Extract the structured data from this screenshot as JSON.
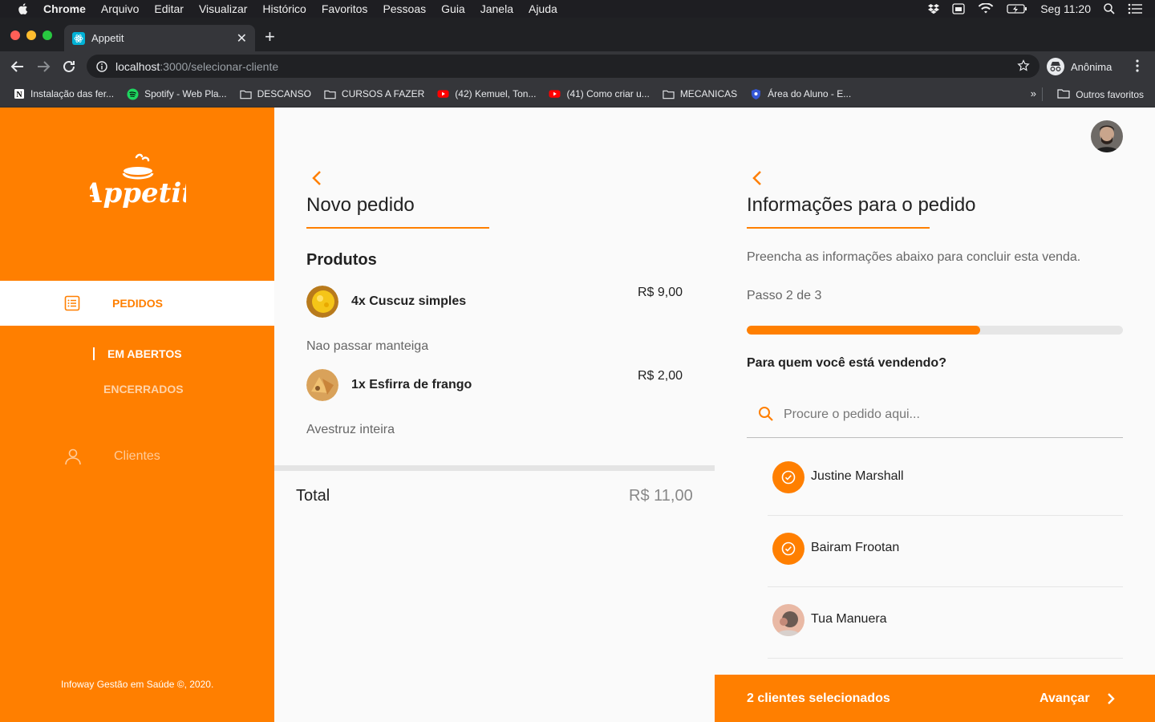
{
  "menubar": {
    "app": "Chrome",
    "items": [
      "Arquivo",
      "Editar",
      "Visualizar",
      "Histórico",
      "Favoritos",
      "Pessoas",
      "Guia",
      "Janela",
      "Ajuda"
    ],
    "clock": "Seg 11:20"
  },
  "browser": {
    "tab_title": "Appetit",
    "url_host": "localhost",
    "url_path": ":3000/selecionar-cliente",
    "profile_label": "Anônima",
    "bookmarks": [
      {
        "label": "Instalação das fer...",
        "icon": "notion-icon"
      },
      {
        "label": "Spotify - Web Pla...",
        "icon": "spotify-icon"
      },
      {
        "label": "DESCANSO",
        "icon": "folder-icon"
      },
      {
        "label": "CURSOS A FAZER",
        "icon": "folder-icon"
      },
      {
        "label": "(42) Kemuel, Ton...",
        "icon": "youtube-icon"
      },
      {
        "label": "(41) Como criar u...",
        "icon": "youtube-icon"
      },
      {
        "label": "MECANICAS",
        "icon": "folder-icon"
      },
      {
        "label": "Área do Aluno - E...",
        "icon": "shield-icon"
      }
    ],
    "bookmarks_more": "»",
    "other_bookmarks": "Outros favoritos"
  },
  "sidebar": {
    "logo_text": "Appetit",
    "nav_active": "PEDIDOS",
    "sub_active": "EM ABERTOS",
    "sub_inactive": "ENCERRADOS",
    "nav_clients": "Clientes",
    "copyright": "Infoway Gestão em Saúde ©, 2020."
  },
  "order": {
    "title": "Novo pedido",
    "products_heading": "Produtos",
    "products": [
      {
        "name": "4x Cuscuz simples",
        "price": "R$ 9,00",
        "note": "Nao passar manteiga"
      },
      {
        "name": "1x Esfirra de frango",
        "price": "R$ 2,00",
        "note": "Avestruz inteira"
      }
    ],
    "total_label": "Total",
    "total_value": "R$ 11,00"
  },
  "info": {
    "title": "Informações para o pedido",
    "description": "Preencha as informações abaixo para concluir esta venda.",
    "step": "Passo 2 de 3",
    "progress": 0.62,
    "question": "Para quem você está vendendo?",
    "search_placeholder": "Procure o pedido aqui...",
    "clients": [
      {
        "name": "Justine Marshall",
        "selected": true
      },
      {
        "name": "Bairam Frootan",
        "selected": true
      },
      {
        "name": "Tua Manuera",
        "selected": false
      }
    ],
    "footer_count": "2 clientes selecionados",
    "footer_next": "Avançar"
  },
  "colors": {
    "accent": "#ff7f00"
  }
}
